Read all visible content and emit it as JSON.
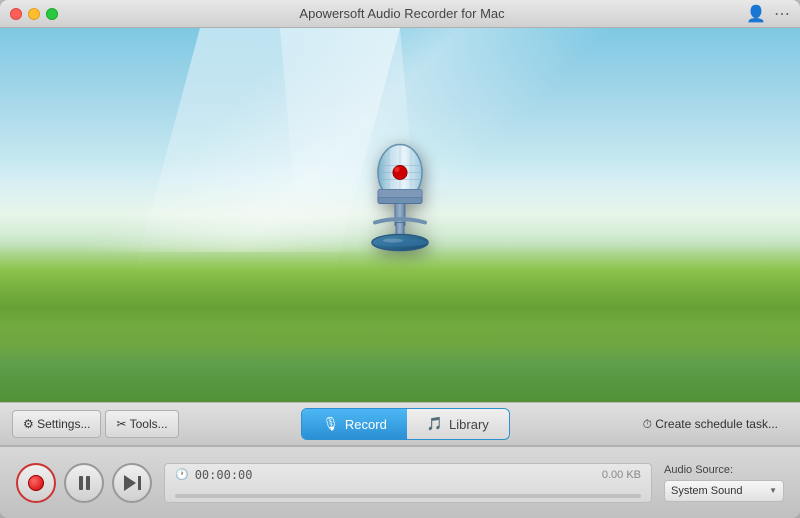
{
  "window": {
    "title": "Apowersoft Audio Recorder for Mac"
  },
  "titlebar": {
    "title": "Apowersoft Audio Recorder for Mac"
  },
  "toolbar": {
    "settings_label": "⚙ Settings...",
    "tools_label": "✂ Tools...",
    "record_tab": "Record",
    "library_tab": "Library",
    "schedule_label": "⏱ Create schedule task..."
  },
  "controls": {
    "time": "00:00:00",
    "file_size": "0.00 KB"
  },
  "audio_source": {
    "label": "Audio Source:",
    "value": "System Sound"
  }
}
